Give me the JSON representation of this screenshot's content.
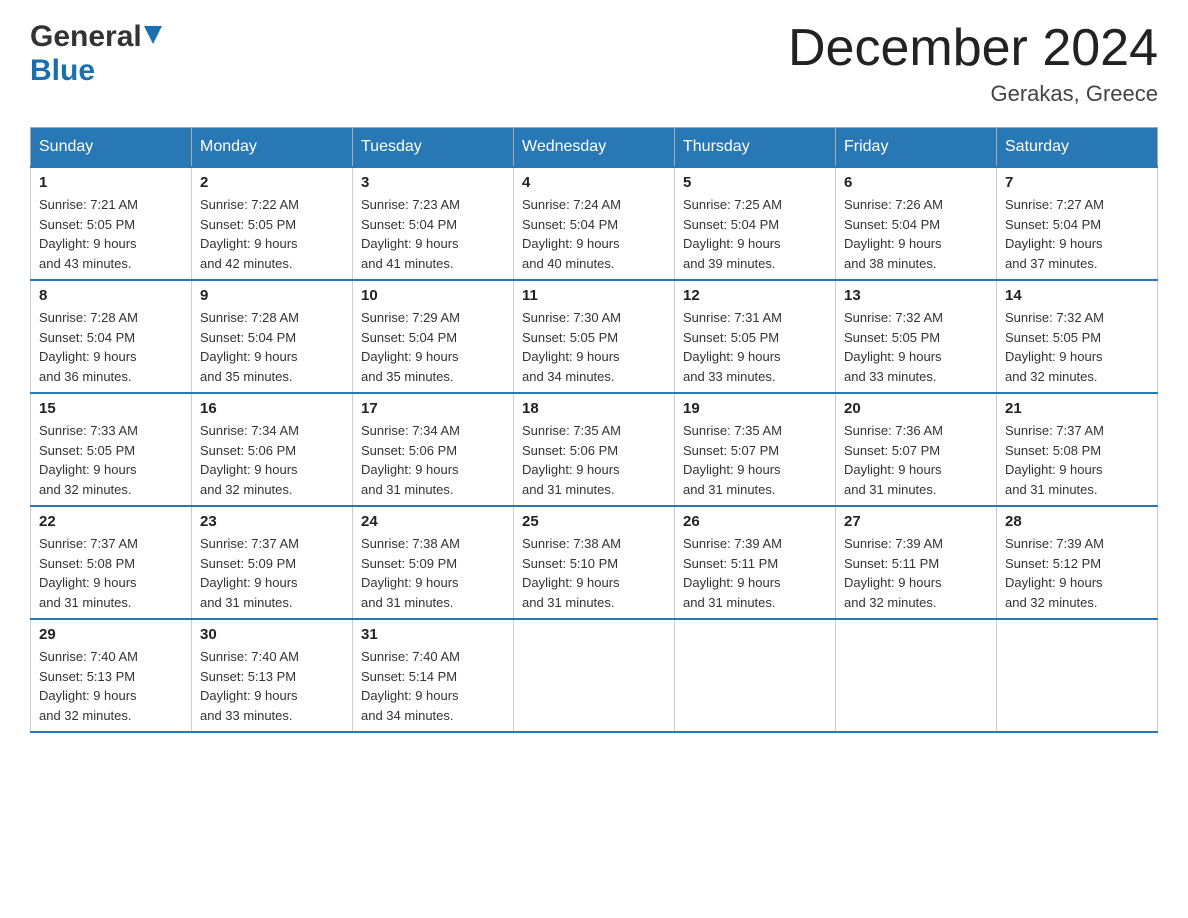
{
  "header": {
    "logo_general": "General",
    "logo_blue": "Blue",
    "month_title": "December 2024",
    "location": "Gerakas, Greece"
  },
  "weekdays": [
    "Sunday",
    "Monday",
    "Tuesday",
    "Wednesday",
    "Thursday",
    "Friday",
    "Saturday"
  ],
  "weeks": [
    [
      {
        "day": "1",
        "sunrise": "7:21 AM",
        "sunset": "5:05 PM",
        "daylight": "9 hours and 43 minutes."
      },
      {
        "day": "2",
        "sunrise": "7:22 AM",
        "sunset": "5:05 PM",
        "daylight": "9 hours and 42 minutes."
      },
      {
        "day": "3",
        "sunrise": "7:23 AM",
        "sunset": "5:04 PM",
        "daylight": "9 hours and 41 minutes."
      },
      {
        "day": "4",
        "sunrise": "7:24 AM",
        "sunset": "5:04 PM",
        "daylight": "9 hours and 40 minutes."
      },
      {
        "day": "5",
        "sunrise": "7:25 AM",
        "sunset": "5:04 PM",
        "daylight": "9 hours and 39 minutes."
      },
      {
        "day": "6",
        "sunrise": "7:26 AM",
        "sunset": "5:04 PM",
        "daylight": "9 hours and 38 minutes."
      },
      {
        "day": "7",
        "sunrise": "7:27 AM",
        "sunset": "5:04 PM",
        "daylight": "9 hours and 37 minutes."
      }
    ],
    [
      {
        "day": "8",
        "sunrise": "7:28 AM",
        "sunset": "5:04 PM",
        "daylight": "9 hours and 36 minutes."
      },
      {
        "day": "9",
        "sunrise": "7:28 AM",
        "sunset": "5:04 PM",
        "daylight": "9 hours and 35 minutes."
      },
      {
        "day": "10",
        "sunrise": "7:29 AM",
        "sunset": "5:04 PM",
        "daylight": "9 hours and 35 minutes."
      },
      {
        "day": "11",
        "sunrise": "7:30 AM",
        "sunset": "5:05 PM",
        "daylight": "9 hours and 34 minutes."
      },
      {
        "day": "12",
        "sunrise": "7:31 AM",
        "sunset": "5:05 PM",
        "daylight": "9 hours and 33 minutes."
      },
      {
        "day": "13",
        "sunrise": "7:32 AM",
        "sunset": "5:05 PM",
        "daylight": "9 hours and 33 minutes."
      },
      {
        "day": "14",
        "sunrise": "7:32 AM",
        "sunset": "5:05 PM",
        "daylight": "9 hours and 32 minutes."
      }
    ],
    [
      {
        "day": "15",
        "sunrise": "7:33 AM",
        "sunset": "5:05 PM",
        "daylight": "9 hours and 32 minutes."
      },
      {
        "day": "16",
        "sunrise": "7:34 AM",
        "sunset": "5:06 PM",
        "daylight": "9 hours and 32 minutes."
      },
      {
        "day": "17",
        "sunrise": "7:34 AM",
        "sunset": "5:06 PM",
        "daylight": "9 hours and 31 minutes."
      },
      {
        "day": "18",
        "sunrise": "7:35 AM",
        "sunset": "5:06 PM",
        "daylight": "9 hours and 31 minutes."
      },
      {
        "day": "19",
        "sunrise": "7:35 AM",
        "sunset": "5:07 PM",
        "daylight": "9 hours and 31 minutes."
      },
      {
        "day": "20",
        "sunrise": "7:36 AM",
        "sunset": "5:07 PM",
        "daylight": "9 hours and 31 minutes."
      },
      {
        "day": "21",
        "sunrise": "7:37 AM",
        "sunset": "5:08 PM",
        "daylight": "9 hours and 31 minutes."
      }
    ],
    [
      {
        "day": "22",
        "sunrise": "7:37 AM",
        "sunset": "5:08 PM",
        "daylight": "9 hours and 31 minutes."
      },
      {
        "day": "23",
        "sunrise": "7:37 AM",
        "sunset": "5:09 PM",
        "daylight": "9 hours and 31 minutes."
      },
      {
        "day": "24",
        "sunrise": "7:38 AM",
        "sunset": "5:09 PM",
        "daylight": "9 hours and 31 minutes."
      },
      {
        "day": "25",
        "sunrise": "7:38 AM",
        "sunset": "5:10 PM",
        "daylight": "9 hours and 31 minutes."
      },
      {
        "day": "26",
        "sunrise": "7:39 AM",
        "sunset": "5:11 PM",
        "daylight": "9 hours and 31 minutes."
      },
      {
        "day": "27",
        "sunrise": "7:39 AM",
        "sunset": "5:11 PM",
        "daylight": "9 hours and 32 minutes."
      },
      {
        "day": "28",
        "sunrise": "7:39 AM",
        "sunset": "5:12 PM",
        "daylight": "9 hours and 32 minutes."
      }
    ],
    [
      {
        "day": "29",
        "sunrise": "7:40 AM",
        "sunset": "5:13 PM",
        "daylight": "9 hours and 32 minutes."
      },
      {
        "day": "30",
        "sunrise": "7:40 AM",
        "sunset": "5:13 PM",
        "daylight": "9 hours and 33 minutes."
      },
      {
        "day": "31",
        "sunrise": "7:40 AM",
        "sunset": "5:14 PM",
        "daylight": "9 hours and 34 minutes."
      },
      null,
      null,
      null,
      null
    ]
  ],
  "labels": {
    "sunrise": "Sunrise:",
    "sunset": "Sunset:",
    "daylight": "Daylight:"
  }
}
